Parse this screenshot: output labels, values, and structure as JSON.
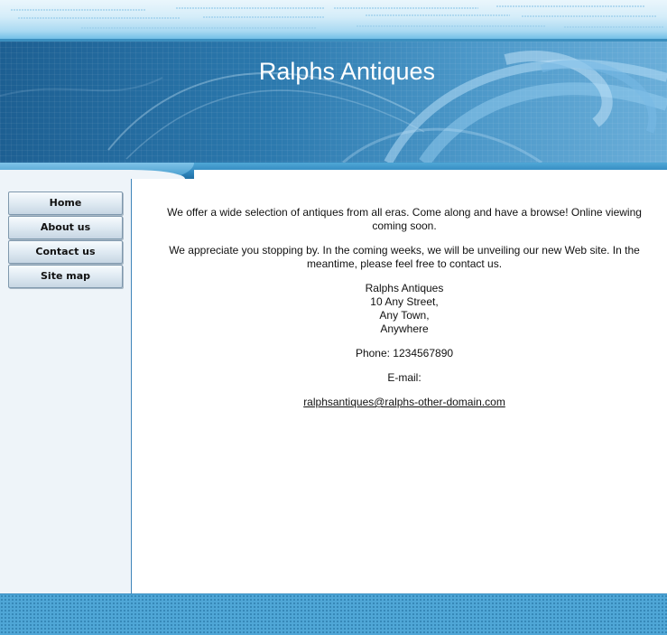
{
  "site": {
    "title": "Ralphs Antiques"
  },
  "nav": {
    "items": [
      {
        "label": "Home"
      },
      {
        "label": "About us"
      },
      {
        "label": "Contact us"
      },
      {
        "label": "Site map"
      }
    ]
  },
  "content": {
    "intro": "We offer a wide selection of antiques from all eras. Come along and have a browse! Online viewing coming soon.",
    "welcome": "We appreciate you stopping by. In the coming weeks, we will be unveiling our new Web site. In the meantime, please feel free to contact us.",
    "address": {
      "name": "Ralphs Antiques",
      "street": "10 Any Street,",
      "town": "Any Town,",
      "region": "Anywhere"
    },
    "phone": "Phone: 1234567890",
    "email_label": "E-mail:",
    "email": "ralphsantiques@ralphs-other-domain.com"
  },
  "colors": {
    "banner": "#2b78ad",
    "sidebar": "#eef4f9",
    "footer": "#4fa6d6",
    "border": "#3f85ba"
  }
}
